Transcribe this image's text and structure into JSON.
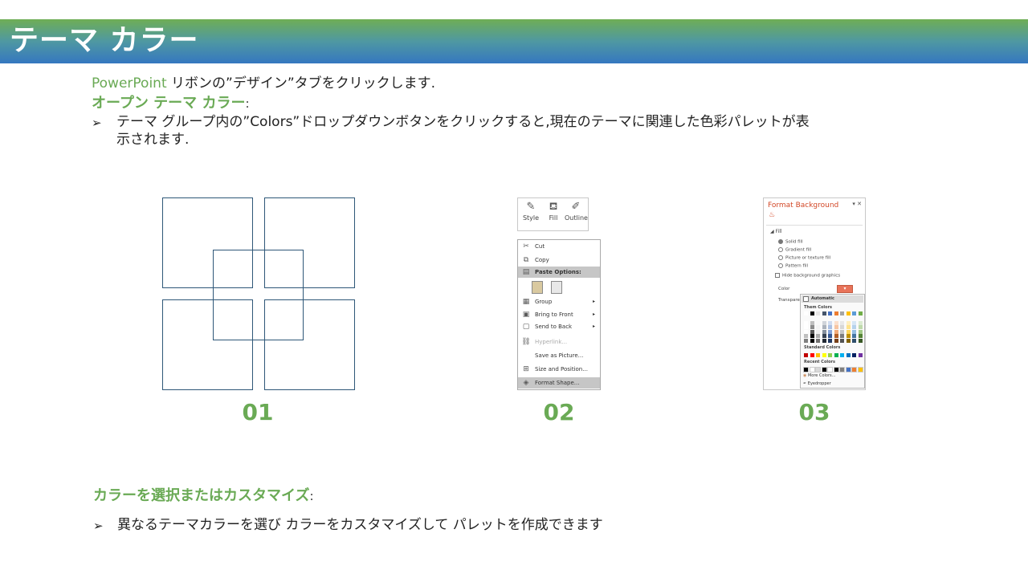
{
  "banner": {
    "title": "テーマ カラー"
  },
  "intro": {
    "brand": "PowerPoint",
    "text": " リボンの”デザイン”タブをクリックします."
  },
  "section1": {
    "heading": "オープン テーマ カラー",
    "colon": ":",
    "bullet": "➢",
    "line1": "テーマ グループ内の”Colors”ドロップダウンボタンをクリックすると,現在のテーマに関連した色彩パレットが表",
    "line2": "示されます."
  },
  "figures": {
    "labels": [
      "01",
      "02",
      "03"
    ],
    "ribbon": [
      "Style",
      "Fill",
      "Outline"
    ],
    "context_menu": [
      {
        "label": "Cut",
        "icon": "scissors-icon",
        "glyph": "✂"
      },
      {
        "label": "Copy",
        "icon": "copy-icon",
        "glyph": "⧉"
      },
      {
        "label": "Paste Options:",
        "icon": "paste-icon",
        "glyph": "📋",
        "highlight": true
      },
      {
        "label": "",
        "icon": "paste-options-icon",
        "glyph": ""
      },
      {
        "label": "Group",
        "icon": "group-icon",
        "glyph": "▦",
        "submenu": true
      },
      {
        "label": "Bring to Front",
        "icon": "bring-front-icon",
        "glyph": "▣",
        "submenu": true
      },
      {
        "label": "Send to Back",
        "icon": "send-back-icon",
        "glyph": "▢",
        "submenu": true
      },
      {
        "label": "Hyperlink...",
        "icon": "hyperlink-icon",
        "glyph": "⛓",
        "disabled": true
      },
      {
        "label": "Save as Picture...",
        "icon": "",
        "glyph": ""
      },
      {
        "label": "Size and Position...",
        "icon": "size-icon",
        "glyph": "⊞"
      },
      {
        "label": "Format Shape...",
        "icon": "format-shape-icon",
        "glyph": "◈",
        "highlight": true
      }
    ],
    "format_background": {
      "title": "Format Background",
      "controls": "▾ ✕",
      "section": "◢ Fill",
      "options": [
        "Solid fill",
        "Gradient fill",
        "Picture or texture fill",
        "Pattern fill"
      ],
      "hide": "Hide background graphics",
      "color_label": "Color",
      "transparency_label": "Transpare",
      "palette": {
        "automatic": "Automatic",
        "theme": "Them Colors",
        "standard": "Standard Colors",
        "recent": "Recent Colors",
        "more": "More Colors...",
        "eyedropper": "Eyedropper"
      }
    }
  },
  "section2": {
    "heading": "カラーを選択またはカスタマイズ",
    "colon": ":",
    "bullet": "➢",
    "text": "異なるテーマカラーを選び カラーをカスタマイズして パレットを作成できます"
  },
  "colors": {
    "accent_green": "#6aaa55",
    "banner_top": "#6fae55",
    "banner_bottom": "#3577c0",
    "square_border": "#2e5778"
  }
}
